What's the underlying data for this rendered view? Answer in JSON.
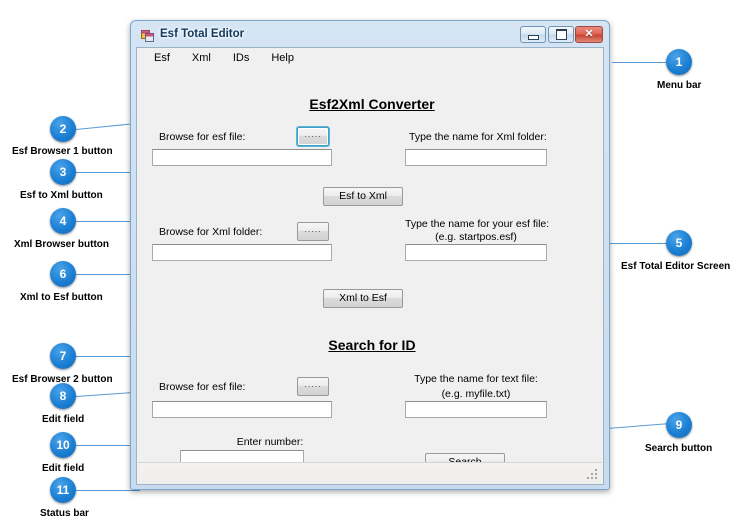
{
  "window": {
    "title": "Esf Total Editor",
    "icon": "form-window-icon",
    "controls": {
      "minimize": "Minimize",
      "maximize": "Maximize",
      "close": "Close"
    }
  },
  "menubar": {
    "items": [
      {
        "label": "Esf"
      },
      {
        "label": "Xml"
      },
      {
        "label": "IDs"
      },
      {
        "label": "Help"
      }
    ]
  },
  "sections": {
    "converter": {
      "title": "Esf2Xml Converter",
      "esf_browse_label": "Browse for esf file:",
      "esf_browse_button": ".....",
      "esf_path_value": "",
      "xml_folder_label": "Type the name for Xml folder:",
      "xml_folder_value": "",
      "esf_to_xml_button": "Esf to Xml",
      "xml_browse_label": "Browse for Xml folder:",
      "xml_browse_button": ".....",
      "xml_path_value": "",
      "esf_name_label_line1": "Type the name for your esf file:",
      "esf_name_label_line2": "(e.g. startpos.esf)",
      "esf_name_value": "",
      "xml_to_esf_button": "Xml to Esf"
    },
    "search": {
      "title": "Search for ID",
      "esf_browse_label": "Browse for esf file:",
      "esf_browse_button": ".....",
      "esf_path_value": "",
      "text_file_label_line1": "Type the name for text file:",
      "text_file_label_line2": "(e.g. myfile.txt)",
      "text_file_value": "",
      "number_label": "Enter number:",
      "number_value": "",
      "search_button": "Search"
    }
  },
  "statusbar": {
    "text": "",
    "grip": "resize-grip"
  },
  "annotations": {
    "accent_color": "#1b7fd4",
    "line_color": "#5b9bd5",
    "items": [
      {
        "number": "1",
        "label": "Menu bar"
      },
      {
        "number": "2",
        "label": "Esf Browser 1 button"
      },
      {
        "number": "3",
        "label": "Esf to Xml button"
      },
      {
        "number": "4",
        "label": "Xml Browser button"
      },
      {
        "number": "5",
        "label": "Esf Total Editor  Screen"
      },
      {
        "number": "6",
        "label": "Xml to Esf button"
      },
      {
        "number": "7",
        "label": "Esf Browser 2 button"
      },
      {
        "number": "8",
        "label": "Edit field"
      },
      {
        "number": "9",
        "label": "Search button"
      },
      {
        "number": "10",
        "label": "Edit field"
      },
      {
        "number": "11",
        "label": "Status bar"
      }
    ]
  }
}
